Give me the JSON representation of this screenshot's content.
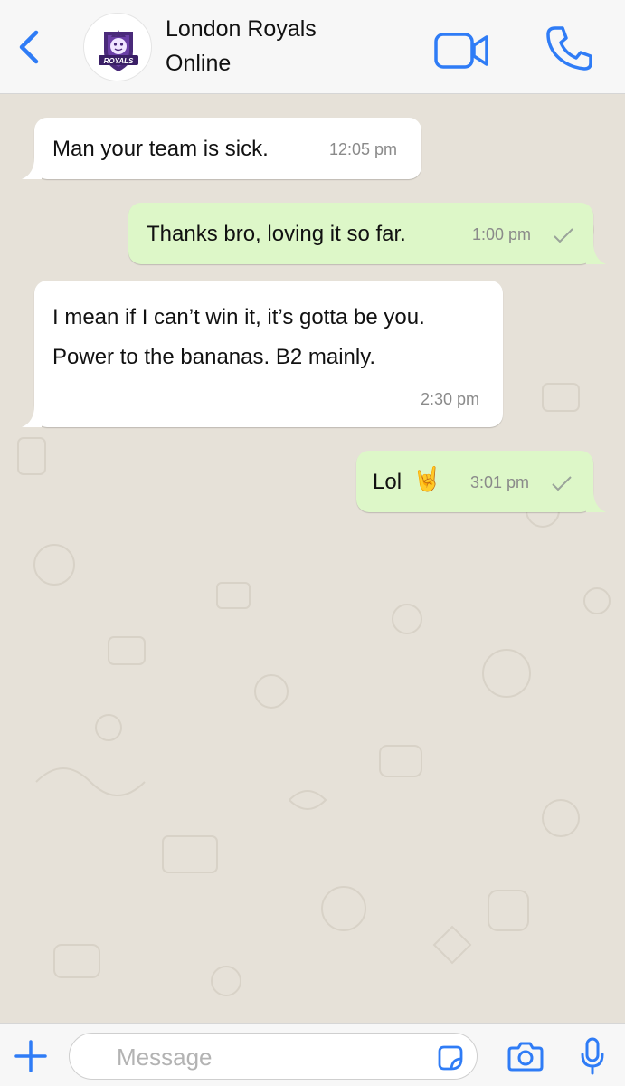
{
  "header": {
    "contact_name": "London Royals",
    "status": "Online",
    "avatar_text": "ROYALS"
  },
  "messages": [
    {
      "direction": "in",
      "lines": [
        "Man your team is sick."
      ],
      "time": "12:05 pm"
    },
    {
      "direction": "out",
      "lines": [
        "Thanks bro, loving it so far."
      ],
      "time": "1:00 pm",
      "tick": "sent"
    },
    {
      "direction": "in",
      "lines": [
        "I mean if I can’t win it, it’s gotta be you.",
        "Power to the bananas. B2 mainly."
      ],
      "time": "2:30 pm"
    },
    {
      "direction": "out",
      "lines": [
        "Lol"
      ],
      "emoji": "🤘",
      "time": "3:01 pm",
      "tick": "sent"
    }
  ],
  "input": {
    "placeholder": "Message"
  },
  "colors": {
    "accent": "#2f7cf6",
    "outgoing_bubble": "#ddf7c8",
    "incoming_bubble": "#ffffff",
    "background": "#e6e1d8"
  },
  "icons": [
    "back-chevron-icon",
    "video-camera-icon",
    "phone-icon",
    "plus-icon",
    "sticker-icon",
    "camera-icon",
    "microphone-icon",
    "check-icon"
  ]
}
